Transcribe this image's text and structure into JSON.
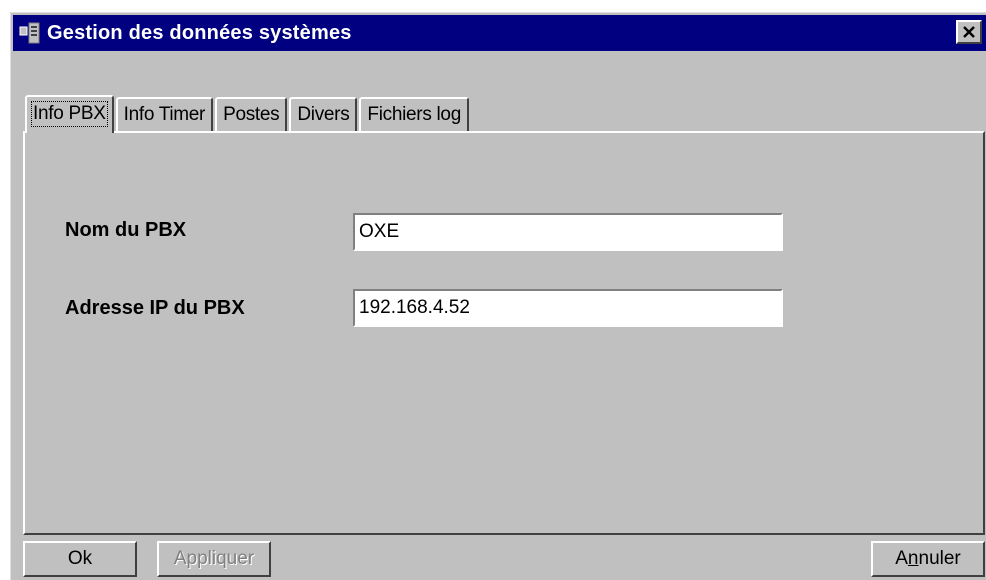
{
  "window": {
    "title": "Gestion des données systèmes",
    "close_glyph": "✕"
  },
  "tabs": [
    {
      "label": "Info PBX",
      "active": true
    },
    {
      "label": "Info Timer",
      "active": false
    },
    {
      "label": "Postes",
      "active": false
    },
    {
      "label": "Divers",
      "active": false
    },
    {
      "label": "Fichiers log",
      "active": false
    }
  ],
  "form": {
    "pbx_name_label": "Nom du PBX",
    "pbx_name_value": "OXE",
    "pbx_ip_label": "Adresse IP du PBX",
    "pbx_ip_value": "192.168.4.52"
  },
  "buttons": {
    "ok_label": "Ok",
    "apply_label": "Appliquer",
    "apply_enabled": false,
    "cancel_label_pre": "A",
    "cancel_label_accel": "n",
    "cancel_label_post": "nuler"
  },
  "colors": {
    "titlebar": "#000080",
    "face": "#c0c0c0"
  },
  "icons": {
    "app": "app-window-icon",
    "close": "close-icon"
  }
}
